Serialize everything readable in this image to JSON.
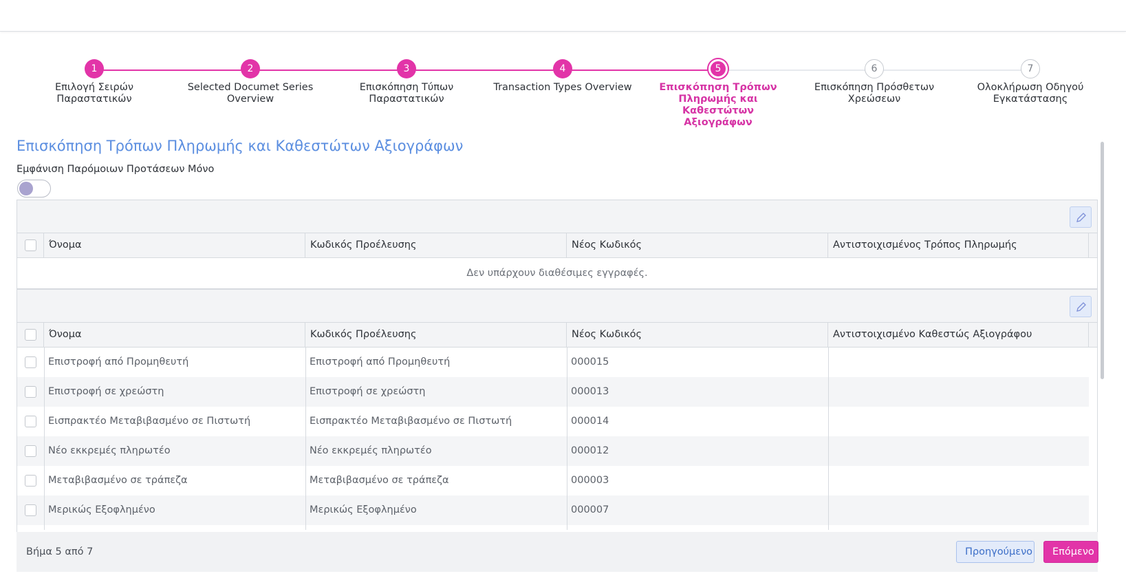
{
  "stepper": {
    "steps": [
      {
        "number": "1",
        "label": "Επιλογή Σειρών Παραστατικών",
        "state": "done"
      },
      {
        "number": "2",
        "label": "Selected Documet Series Overview",
        "state": "done"
      },
      {
        "number": "3",
        "label": "Επισκόπηση Τύπων Παραστατικών",
        "state": "done"
      },
      {
        "number": "4",
        "label": "Transaction Types Overview",
        "state": "done"
      },
      {
        "number": "5",
        "label": "Επισκόπηση Τρόπων Πληρωμής και Καθεστώτων Αξιογράφων",
        "state": "current"
      },
      {
        "number": "6",
        "label": "Επισκόπηση Πρόσθετων Χρεώσεων",
        "state": "pending"
      },
      {
        "number": "7",
        "label": "Ολοκλήρωση Οδηγού Εγκατάστασης",
        "state": "pending"
      }
    ],
    "colors": {
      "done": "#e234a8",
      "pending": "#e6e9ed"
    }
  },
  "main": {
    "title": "Επισκόπηση Τρόπων Πληρωμής και Καθεστώτων Αξιογράφων",
    "toggle_label": "Εμφάνιση Παρόμοιων Προτάσεων Μόνο",
    "toggle_on": false
  },
  "payment_table": {
    "columns": [
      "Όνομα",
      "Κωδικός Προέλευσης",
      "Νέος Κωδικός",
      "Αντιστοιχισμένος Τρόπος Πληρωμής"
    ],
    "empty_text": "Δεν υπάρχουν διαθέσιμες εγγραφές."
  },
  "status_table": {
    "columns": [
      "Όνομα",
      "Κωδικός Προέλευσης",
      "Νέος Κωδικός",
      "Αντιστοιχισμένο Καθεστώς Αξιογράφου"
    ],
    "rows": [
      {
        "name": "Επιστροφή από Προμηθευτή",
        "source_code": "Επιστροφή από Προμηθευτή",
        "new_code": "000015",
        "mapped": ""
      },
      {
        "name": "Επιστροφή σε χρεώστη",
        "source_code": "Επιστροφή σε χρεώστη",
        "new_code": "000013",
        "mapped": ""
      },
      {
        "name": "Εισπρακτέο Μεταβιβασμένο σε Πιστωτή",
        "source_code": "Εισπρακτέο Μεταβιβασμένο σε Πιστωτή",
        "new_code": "000014",
        "mapped": ""
      },
      {
        "name": "Νέο εκκρεμές πληρωτέο",
        "source_code": "Νέο εκκρεμές πληρωτέο",
        "new_code": "000012",
        "mapped": ""
      },
      {
        "name": "Μεταβιβασμένο σε τράπεζα",
        "source_code": "Μεταβιβασμένο σε τράπεζα",
        "new_code": "000003",
        "mapped": ""
      },
      {
        "name": "Μερικώς Εξοφλημένο",
        "source_code": "Μερικώς Εξοφλημένο",
        "new_code": "000007",
        "mapped": ""
      }
    ]
  },
  "footer": {
    "step_info": "Βήμα 5 από 7",
    "prev_label": "Προηγούμενο",
    "next_label": "Επόμενο"
  },
  "icons": {
    "edit": "pencil-icon",
    "accent": "#e234a8",
    "title_color": "#5b8ee0"
  }
}
